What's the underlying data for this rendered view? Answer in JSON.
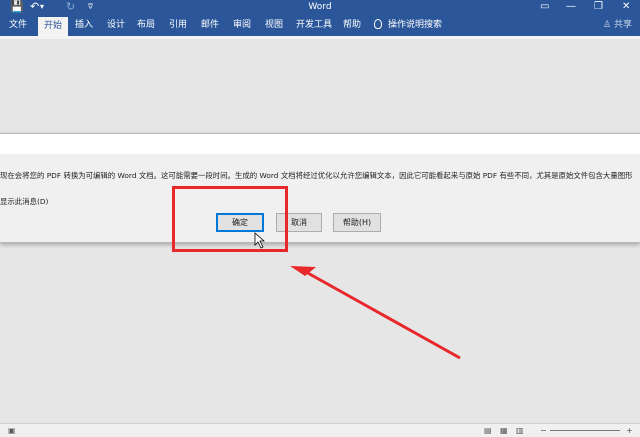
{
  "window": {
    "title": "Word",
    "minimize": "—",
    "restore": "❐",
    "close": "✕",
    "ribbon_toggle": "▭"
  },
  "qat": {
    "save": "💾",
    "undo": "↶",
    "undo_dropdown": "▾",
    "redo": "↻",
    "customize": "⩢"
  },
  "ribbon": {
    "tabs": [
      "文件",
      "开始",
      "插入",
      "设计",
      "布局",
      "引用",
      "邮件",
      "审阅",
      "视图",
      "开发工具",
      "帮助"
    ],
    "active": "开始",
    "search": "操作说明搜索",
    "share": "共享"
  },
  "dialog": {
    "message": "现在会将您的 PDF 转换为可编辑的 Word 文档。这可能需要一段时间。生成的 Word 文档将经过优化以允许您编辑文本，因此它可能看起来与原始 PDF 有些不同，尤其是原始文件包含大量图形",
    "checkbox_label": "显示此消息(D)",
    "ok": "确定",
    "cancel": "取消",
    "help": "帮助(H)"
  }
}
